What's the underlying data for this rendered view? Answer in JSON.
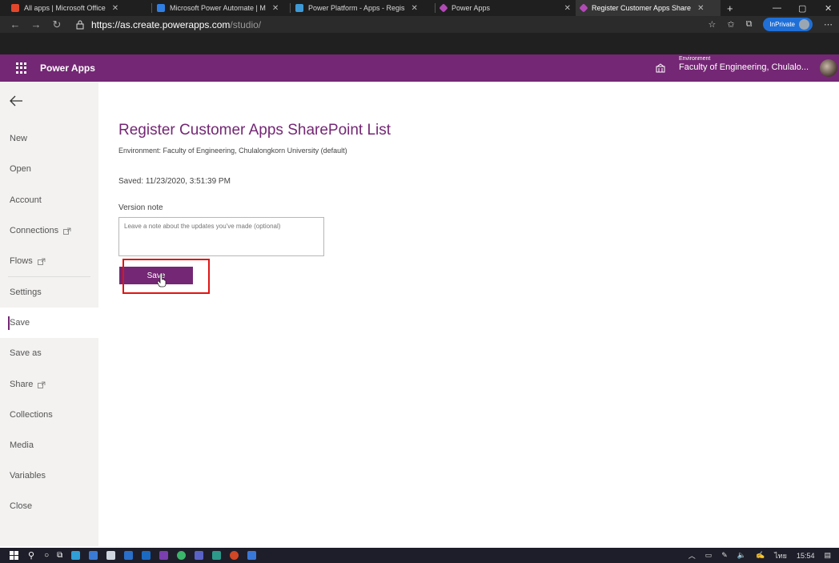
{
  "browser": {
    "tabs": [
      {
        "title": "All apps | Microsoft Office",
        "icon": "office-icon",
        "color": "#e2472b"
      },
      {
        "title": "Microsoft Power Automate | M",
        "icon": "power-automate-icon",
        "color": "#2f7fe3"
      },
      {
        "title": "Power Platform - Apps - Regis",
        "icon": "power-platform-icon",
        "color": "#3e9ad6"
      },
      {
        "title": "Power Apps",
        "icon": "power-apps-icon",
        "color": "#b24ab6"
      },
      {
        "title": "Register Customer Apps Share",
        "icon": "power-apps-icon",
        "color": "#b24ab6"
      }
    ],
    "url_host": "https://as.create.powerapps.com",
    "url_path": "/studio/",
    "inprivate_label": "InPrivate"
  },
  "header": {
    "app_name": "Power Apps",
    "environment_label": "Environment",
    "environment_name": "Faculty of Engineering, Chulalo..."
  },
  "sidebar": {
    "items": [
      {
        "label": "New"
      },
      {
        "label": "Open"
      },
      {
        "label": "Account"
      },
      {
        "label": "Connections"
      },
      {
        "label": "Flows"
      },
      {
        "label": "Settings"
      },
      {
        "label": "Save"
      },
      {
        "label": "Save as"
      },
      {
        "label": "Share"
      },
      {
        "label": "Collections"
      },
      {
        "label": "Media"
      },
      {
        "label": "Variables"
      },
      {
        "label": "Close"
      }
    ]
  },
  "main": {
    "title": "Register Customer Apps SharePoint List",
    "environment": "Environment: Faculty of Engineering, Chulalongkorn University (default)",
    "saved": "Saved: 11/23/2020, 3:51:39 PM",
    "version_note_label": "Version note",
    "version_note_placeholder": "Leave a note about the updates you've made (optional)",
    "version_note_value": "",
    "save_label": "Save"
  },
  "taskbar": {
    "lang": "ไทย",
    "time": "15:54"
  },
  "colors": {
    "brand": "#742774",
    "highlight": "#e11414"
  }
}
